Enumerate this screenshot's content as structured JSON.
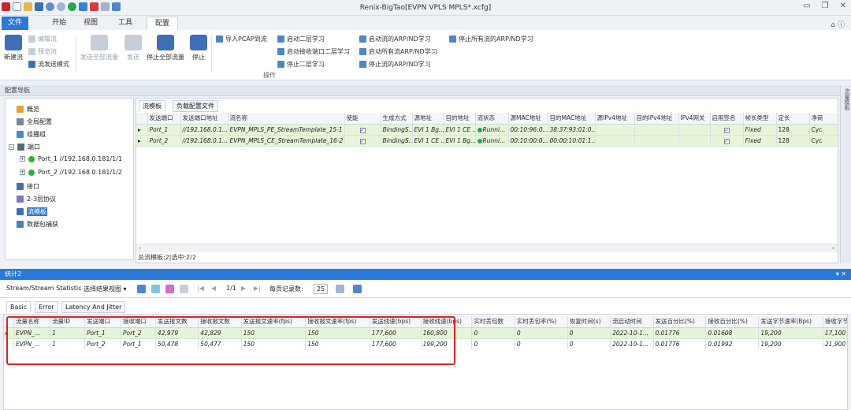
{
  "window": {
    "title": "Renix-BigTao[EVPN  VPLS MPLS*.xcfg]"
  },
  "tabs": [
    "文件",
    "开始",
    "视图",
    "工具",
    "配置"
  ],
  "ribbon": {
    "new_stream": "新建流",
    "edit_stream": "编辑流",
    "preview_stream": "预览流",
    "send_mode": "流发送模式",
    "send_all": "发送全部流量",
    "send": "发送",
    "stop_all": "停止全部流量",
    "stop": "停止",
    "import_pcap": "导入PCAP到流",
    "start_l2": "启动二层学习",
    "start_rx_l2": "启动接收端口二层学习",
    "stop_l2": "停止二层学习",
    "start_arp": "启动流的ARP/ND学习",
    "start_all_arp": "启动所有流ARP/ND学习",
    "stop_arp": "停止流的ARP/ND学习",
    "stop_all_arp": "停止所有流的ARP/ND学习",
    "group_label": "操作"
  },
  "nav": {
    "header": "配置导航",
    "right_strip": "流量模板",
    "items": [
      "概览",
      "全局配置",
      "组播组",
      "端口",
      "Port_1 //192.168.0.181/1/1",
      "Port_2 //192.168.0.181/1/2",
      "接口",
      "2-3层协议",
      "流模板",
      "数据包捕获"
    ]
  },
  "stream_panel": {
    "tabs": [
      "流模板",
      "负载配置文件"
    ],
    "columns": [
      "发送端口",
      "发送端口地址",
      "流名称",
      "使能",
      "生成方式",
      "源地址",
      "目的地址",
      "流状态",
      "源MAC地址",
      "目的MAC地址",
      "源IPv4地址",
      "目的IPv4地址",
      "IPv4网关",
      "启用签名",
      "帧长类型",
      "定长",
      "净荷"
    ],
    "rows": [
      [
        "Port_1",
        "//192.168.0.1...",
        "EVPN_MPLS_PE_StreamTemplate_15-1",
        "✓",
        "BindingS...",
        "EVI 1 Bg...",
        "EVI 1 CE ...",
        "Runni...",
        "00:10:96:0...",
        "38:37:93:01:0...",
        "",
        "",
        "",
        "✓",
        "Fixed",
        "128",
        "Cyc"
      ],
      [
        "Port_2",
        "//192.168.0.1...",
        "EVPN_MPLS_CE_StreamTemplate_16-2",
        "✓",
        "BindingS...",
        "EVI 1 CE ...",
        "EVI 1 Bg...",
        "Runni...",
        "00:10:00:0...",
        "00:00:10:01:1...",
        "",
        "",
        "",
        "✓",
        "Fixed",
        "128",
        "Cyc"
      ]
    ],
    "status": "总流模板:2|选中:2/2"
  },
  "stats": {
    "title": "统计2",
    "controls": "▾ ✕",
    "view_name": "Stream/Stream Statistic",
    "view_select": "选择结果视图",
    "page": "1/1",
    "per_page_label": "每页记录数:",
    "per_page": "25",
    "subtabs": [
      "Basic",
      "Error",
      "Latency And Jitter"
    ],
    "columns": [
      "流量名称",
      "流量ID",
      "发送端口",
      "接收端口",
      "发送报文数",
      "接收报文数",
      "发送报文速率(fps)",
      "接收报文速率(fps)",
      "发送线速(bps)",
      "接收线速(bps)",
      "实时丢包数",
      "实时丢包率(%)",
      "恢复时间(s)",
      "流启动时间",
      "发送百分比(%)",
      "接收百分比(%)",
      "发送字节速率(Bps)",
      "接收字节速率"
    ],
    "rows": [
      [
        "EVPN_...",
        "1",
        "Port_1",
        "Port_2",
        "42,979",
        "42,829",
        "150",
        "150",
        "177,600",
        "160,800",
        "0",
        "0",
        "0",
        "2022-10-1...",
        "0.01776",
        "0.01608",
        "19,200",
        "17,100"
      ],
      [
        "EVPN_...",
        "1",
        "Port_2",
        "Port_1",
        "50,478",
        "50,477",
        "150",
        "150",
        "177,600",
        "199,200",
        "0",
        "0",
        "0",
        "2022-10-1...",
        "0.01776",
        "0.01992",
        "19,200",
        "21,900"
      ]
    ]
  }
}
